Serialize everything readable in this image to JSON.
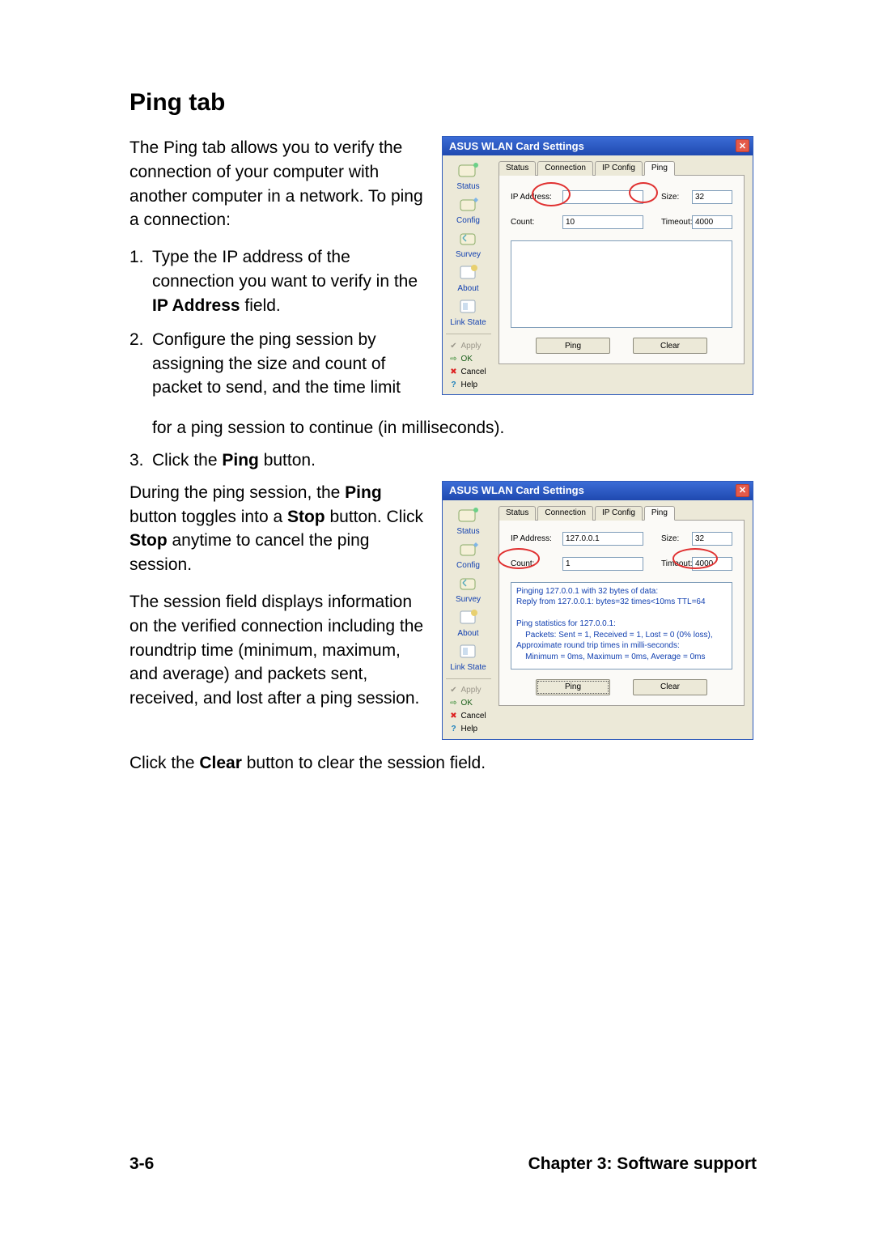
{
  "heading": "Ping tab",
  "intro": "The Ping tab allows you to verify the connection of your computer with another computer in a network. To ping a connection:",
  "steps": [
    {
      "num": "1.",
      "pre": "Type the IP address of the connection you want to verify in the ",
      "bold": "IP Address",
      "post": " field."
    },
    {
      "num": "2.",
      "pre": "Configure the ping session by assigning the size and count of packet to send, and the time limit",
      "bold": "",
      "post": ""
    }
  ],
  "step2_cont": "for a ping session to continue (in milliseconds).",
  "step3": {
    "num": "3.",
    "pre": "Click the ",
    "bold": "Ping",
    "post": " button."
  },
  "ping_session_p1a": "During the ping session, the ",
  "ping_session_b1": "Ping",
  "ping_session_p1b": " button toggles into a ",
  "ping_session_b2": "Stop",
  "ping_session_p1c": " button. Click ",
  "ping_session_b3": "Stop",
  "ping_session_p1d": " anytime to cancel the ping session.",
  "session_field_para": "The session field displays information on the verified connection including the roundtrip time (minimum, maximum, and average) and packets sent, received, and lost after a ping session.",
  "clear_line_a": "Click the ",
  "clear_line_bold": "Clear",
  "clear_line_b": " button to clear the session field.",
  "footer": {
    "left": "3-6",
    "right": "Chapter 3: Software support"
  },
  "dlg_common": {
    "title": "ASUS WLAN Card Settings",
    "close_glyph": "✕",
    "sidebar_items": [
      {
        "label": "Status"
      },
      {
        "label": "Config"
      },
      {
        "label": "Survey"
      },
      {
        "label": "About"
      },
      {
        "label": "Link State"
      }
    ],
    "side_btn_apply": "Apply",
    "side_btn_ok": "OK",
    "side_btn_cancel": "Cancel",
    "side_btn_help": "Help",
    "tabs": [
      "Status",
      "Connection",
      "IP Config",
      "Ping"
    ],
    "active_tab": "Ping",
    "labels": {
      "ip": "IP Address:",
      "count": "Count:",
      "size": "Size:",
      "timeout": "Timeout:"
    },
    "btn_ping": "Ping",
    "btn_clear": "Clear"
  },
  "dlg1": {
    "ip": "",
    "count": "10",
    "size": "32",
    "timeout": "4000",
    "log": ""
  },
  "dlg2": {
    "ip": "127.0.0.1",
    "count": "1",
    "size": "32",
    "timeout": "4000",
    "log_lines": [
      "Pinging 127.0.0.1 with 32 bytes of data:",
      "Reply from 127.0.0.1: bytes=32 times<10ms TTL=64",
      "",
      "Ping statistics for 127.0.0.1:",
      "    Packets: Sent = 1, Received = 1, Lost = 0 (0% loss),",
      "Approximate round trip times in milli-seconds:",
      "    Minimum = 0ms, Maximum = 0ms, Average = 0ms"
    ]
  }
}
